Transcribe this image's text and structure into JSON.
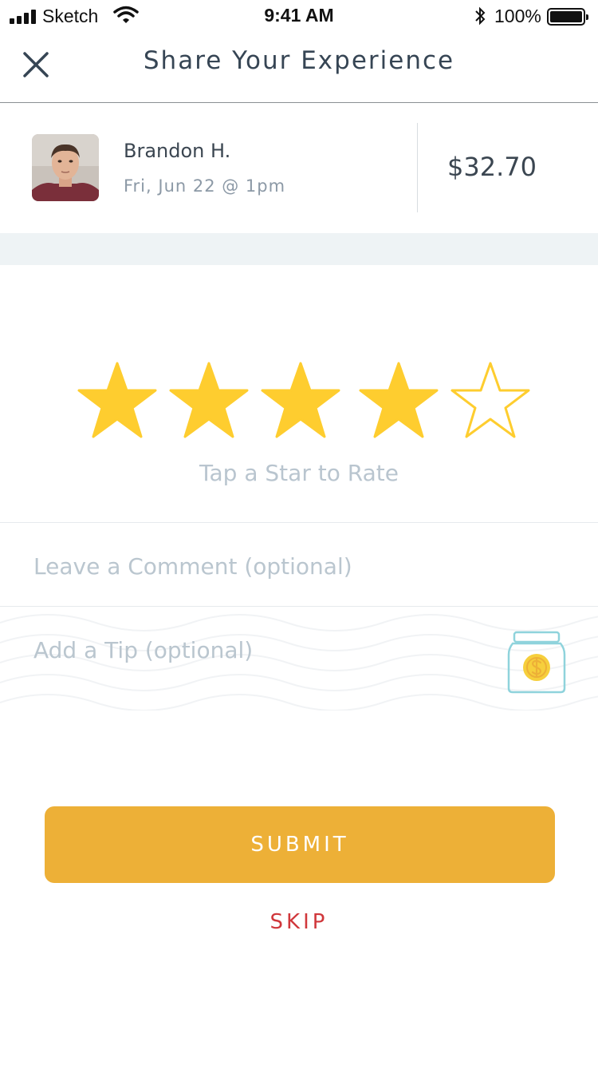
{
  "status_bar": {
    "carrier": "Sketch",
    "time": "9:41 AM",
    "battery": "100%"
  },
  "nav": {
    "title": "Share Your Experience",
    "close_icon": "close-icon"
  },
  "appointment": {
    "name": "Brandon H.",
    "datetime": "Fri, Jun 22 @ 1pm",
    "price": "$32.70"
  },
  "rating": {
    "value": 4,
    "max": 5,
    "hint": "Tap a Star to Rate",
    "star_color": "#fecd2f",
    "icon": "star-icon"
  },
  "comment": {
    "placeholder": "Leave a Comment (optional)"
  },
  "tip": {
    "placeholder": "Add a Tip (optional)",
    "icon": "tip-jar-icon"
  },
  "actions": {
    "submit_label": "SUBMIT",
    "skip_label": "SKIP",
    "submit_color": "#edb037",
    "skip_color": "#d0373b"
  }
}
